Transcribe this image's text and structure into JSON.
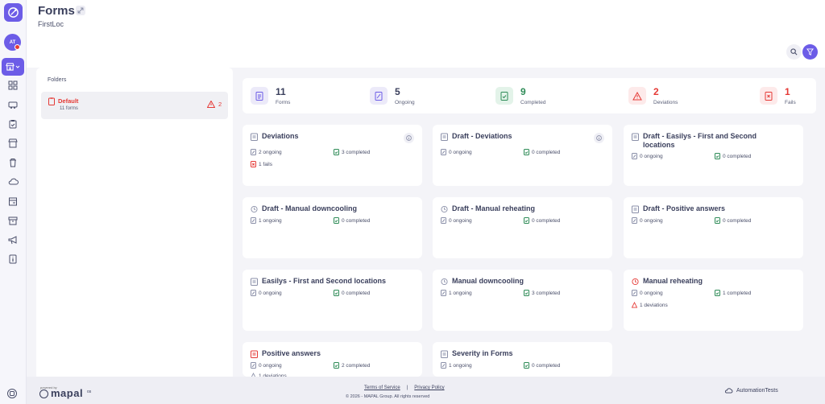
{
  "header": {
    "title": "Forms",
    "subtitle": "FirstLoc"
  },
  "user": {
    "initials": "AT"
  },
  "colors": {
    "accent": "#6c5ce7",
    "danger": "#e53935",
    "success": "#2e8b57"
  },
  "nav": {
    "icons": [
      "dashboard-icon",
      "truck-icon",
      "clipboard-icon",
      "store-icon",
      "trash-icon",
      "cloud-icon",
      "box-icon",
      "archive-icon",
      "megaphone-icon",
      "info-book-icon"
    ]
  },
  "folders": {
    "title": "Folders",
    "items": [
      {
        "name": "Default",
        "count": "11 forms",
        "alerts": "2"
      }
    ]
  },
  "summary": [
    {
      "value": "11",
      "label": "Forms"
    },
    {
      "value": "5",
      "label": "Ongoing"
    },
    {
      "value": "9",
      "label": "Completed"
    },
    {
      "value": "2",
      "label": "Deviations"
    },
    {
      "value": "1",
      "label": "Fails"
    }
  ],
  "cards": [
    {
      "title": "Deviations",
      "ongoing": "2 ongoing",
      "completed": "3 completed",
      "extra": "1 fails"
    },
    {
      "title": "Draft - Deviations",
      "ongoing": "0 ongoing",
      "completed": "0 completed"
    },
    {
      "title": "Draft - Easilys - First and Second locations",
      "ongoing": "0 ongoing",
      "completed": "0 completed"
    },
    {
      "title": "Draft - Manual downcooling",
      "ongoing": "1 ongoing",
      "completed": "0 completed"
    },
    {
      "title": "Draft - Manual reheating",
      "ongoing": "0 ongoing",
      "completed": "0 completed"
    },
    {
      "title": "Draft - Positive answers",
      "ongoing": "0 ongoing",
      "completed": "0 completed"
    },
    {
      "title": "Easilys - First and Second locations",
      "ongoing": "0 ongoing",
      "completed": "0 completed"
    },
    {
      "title": "Manual downcooling",
      "ongoing": "1 ongoing",
      "completed": "3 completed"
    },
    {
      "title": "Manual reheating",
      "ongoing": "0 ongoing",
      "completed": "1 completed",
      "extra": "1 deviations"
    },
    {
      "title": "Positive answers",
      "ongoing": "0 ongoing",
      "completed": "2 completed",
      "extra": "1 deviations"
    },
    {
      "title": "Severity in Forms",
      "ongoing": "1 ongoing",
      "completed": "0 completed"
    }
  ],
  "footer": {
    "powered": "powered by",
    "brand": "mapal",
    "brand_suffix": "os",
    "terms": "Terms of Service",
    "separator": "|",
    "privacy": "Privacy Policy",
    "copyright": "© 2026 - MAPAL Group. All rights reserved",
    "account": "AutomationTests"
  }
}
